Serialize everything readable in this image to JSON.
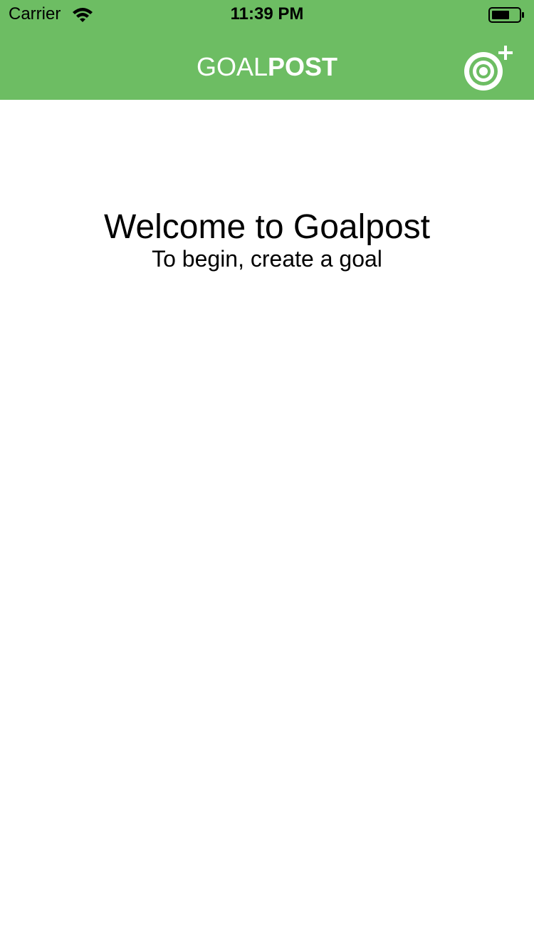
{
  "status_bar": {
    "carrier": "Carrier",
    "time": "11:39 PM",
    "wifi_icon": "wifi-icon",
    "battery_icon": "battery-icon"
  },
  "nav": {
    "title_light": "GOAL",
    "title_bold": "POST",
    "add_button_icon": "target-plus-icon",
    "background_color": "#6DBD63"
  },
  "main": {
    "welcome_title": "Welcome to Goalpost",
    "welcome_subtitle": "To begin, create a goal"
  }
}
